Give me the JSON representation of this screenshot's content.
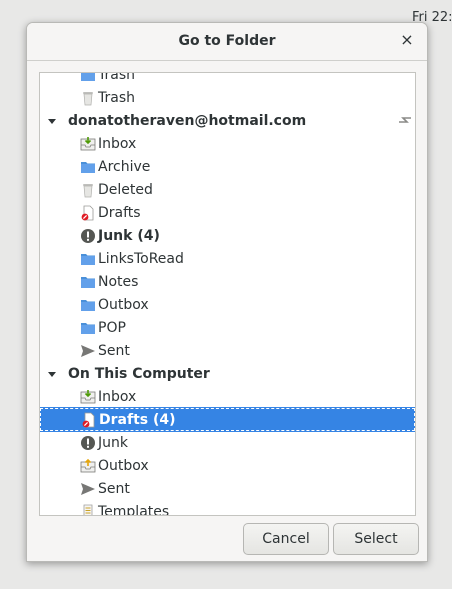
{
  "clock": "Fri 22:",
  "dialog": {
    "title": "Go to Folder",
    "close_glyph": "×"
  },
  "tree": {
    "items": [
      {
        "label": "Trash",
        "icon": "folder-icon",
        "bold": false
      },
      {
        "label": "Trash",
        "icon": "trash-icon",
        "bold": false
      },
      {
        "label": "donatotheraven@hotmail.com",
        "icon": "",
        "bold": true,
        "account": true
      },
      {
        "label": "Inbox",
        "icon": "inbox-icon",
        "bold": false
      },
      {
        "label": "Archive",
        "icon": "folder-icon",
        "bold": false
      },
      {
        "label": "Deleted",
        "icon": "trash-icon",
        "bold": false
      },
      {
        "label": "Drafts",
        "icon": "drafts-icon",
        "bold": false
      },
      {
        "label": "Junk (4)",
        "icon": "junk-icon",
        "bold": true
      },
      {
        "label": "LinksToRead",
        "icon": "folder-icon",
        "bold": false
      },
      {
        "label": "Notes",
        "icon": "folder-icon",
        "bold": false
      },
      {
        "label": "Outbox",
        "icon": "folder-icon",
        "bold": false
      },
      {
        "label": "POP",
        "icon": "folder-icon",
        "bold": false
      },
      {
        "label": "Sent",
        "icon": "sent-icon",
        "bold": false
      },
      {
        "label": "On This Computer",
        "icon": "",
        "bold": true,
        "account": true
      },
      {
        "label": "Inbox",
        "icon": "inbox-icon",
        "bold": false
      },
      {
        "label": "Drafts (4)",
        "icon": "drafts-icon",
        "bold": true,
        "selected": true
      },
      {
        "label": "Junk",
        "icon": "junk-icon",
        "bold": false
      },
      {
        "label": "Outbox",
        "icon": "outbox-icon",
        "bold": false
      },
      {
        "label": "Sent",
        "icon": "sent-icon",
        "bold": false
      },
      {
        "label": "Templates",
        "icon": "templates-icon",
        "bold": false
      }
    ]
  },
  "buttons": {
    "cancel": "Cancel",
    "select": "Select"
  },
  "colors": {
    "selection": "#3584e4",
    "folder": "#4a90d9"
  }
}
